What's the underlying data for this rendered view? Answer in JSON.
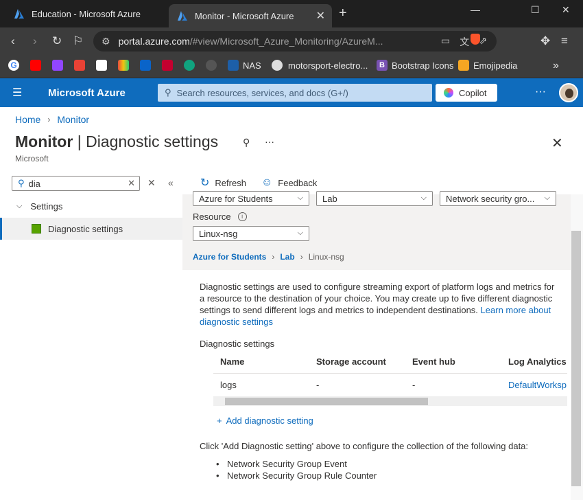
{
  "browser": {
    "tabs": [
      {
        "title": "Education - Microsoft Azure",
        "active": false
      },
      {
        "title": "Monitor - Microsoft Azure",
        "active": true
      }
    ],
    "url_host": "portal.azure.com",
    "url_path": "/#view/Microsoft_Azure_Monitoring/AzureM...",
    "shield_count": "1",
    "bookmarks": [
      {
        "label": "NAS",
        "icon": "dsm-icon"
      },
      {
        "label": "motorsport-electro...",
        "icon": "globe-icon"
      },
      {
        "label": "Bootstrap Icons",
        "icon": "bootstrap-icon"
      },
      {
        "label": "Emojipedia",
        "icon": "emojipedia-icon"
      }
    ]
  },
  "azure": {
    "brand": "Microsoft Azure",
    "search_placeholder": "Search resources, services, and docs (G+/)",
    "copilot_label": "Copilot",
    "accent": "#0f6cbd"
  },
  "page": {
    "breadcrumb": [
      "Home",
      "Monitor"
    ],
    "title_main": "Monitor",
    "title_sep": " | ",
    "title_sub": "Diagnostic settings",
    "subtitle": "Microsoft"
  },
  "menu": {
    "filter_value": "dia",
    "group_label": "Settings",
    "item_label": "Diagnostic settings"
  },
  "toolbar": {
    "refresh": "Refresh",
    "feedback": "Feedback"
  },
  "filters": {
    "subscription": "Azure for Students",
    "resource_group": "Lab",
    "resource_type": "Network security gro...",
    "resource_label": "Resource",
    "resource": "Linux-nsg",
    "path": [
      "Azure for Students",
      "Lab",
      "Linux-nsg"
    ]
  },
  "content": {
    "description": "Diagnostic settings are used to configure streaming export of platform logs and metrics for a resource to the destination of your choice. You may create up to five different diagnostic settings to send different logs and metrics to independent destinations.",
    "learn_more": "Learn more about diagnostic settings",
    "section_label": "Diagnostic settings",
    "columns": [
      "Name",
      "Storage account",
      "Event hub",
      "Log Analytics w"
    ],
    "rows": [
      {
        "name": "logs",
        "storage": "-",
        "eventhub": "-",
        "loganalytics": "DefaultWorksp"
      }
    ],
    "add_label": "Add diagnostic setting",
    "click_msg": "Click 'Add Diagnostic setting' above to configure the collection of the following data:",
    "data_items": [
      "Network Security Group Event",
      "Network Security Group Rule Counter"
    ]
  }
}
